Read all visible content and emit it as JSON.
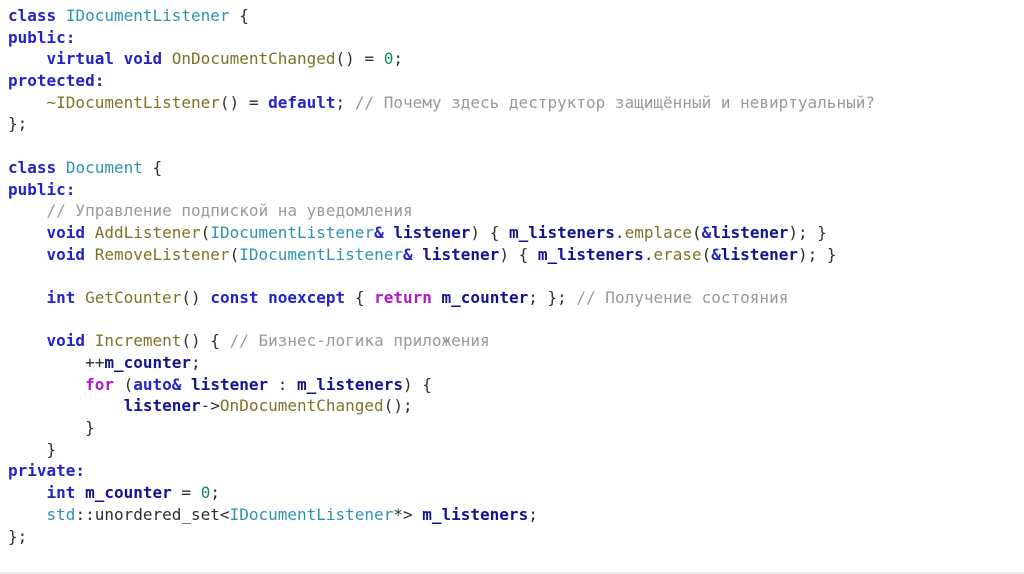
{
  "colors": {
    "keyword": "#2323c8",
    "control": "#b119c8",
    "type": "#2e93af",
    "function": "#7e7128",
    "variable": "#13138f",
    "number": "#12875f",
    "comment": "#9a9a9a",
    "plain": "#2e2e2e",
    "edge": "#ececec",
    "background": "#ffffff"
  },
  "code": {
    "language": "cpp",
    "lines": [
      {
        "tokens": [
          {
            "text": "class",
            "style": "keyword"
          },
          {
            "text": " ",
            "style": "plain"
          },
          {
            "text": "IDocumentListener",
            "style": "type"
          },
          {
            "text": " {",
            "style": "plain"
          }
        ]
      },
      {
        "tokens": [
          {
            "text": "public:",
            "style": "keyword"
          }
        ]
      },
      {
        "tokens": [
          {
            "text": "    ",
            "style": "plain"
          },
          {
            "text": "virtual",
            "style": "keyword"
          },
          {
            "text": " ",
            "style": "plain"
          },
          {
            "text": "void",
            "style": "keyword"
          },
          {
            "text": " ",
            "style": "plain"
          },
          {
            "text": "OnDocumentChanged",
            "style": "function"
          },
          {
            "text": "() = ",
            "style": "plain"
          },
          {
            "text": "0",
            "style": "number"
          },
          {
            "text": ";",
            "style": "plain"
          }
        ]
      },
      {
        "tokens": [
          {
            "text": "protected:",
            "style": "keyword"
          }
        ]
      },
      {
        "tokens": [
          {
            "text": "    ",
            "style": "plain"
          },
          {
            "text": "~IDocumentListener",
            "style": "function"
          },
          {
            "text": "() = ",
            "style": "plain"
          },
          {
            "text": "default",
            "style": "keyword"
          },
          {
            "text": "; ",
            "style": "plain"
          },
          {
            "text": "// Почему здесь деструктор защищённый и невиртуальный?",
            "style": "comment"
          }
        ]
      },
      {
        "tokens": [
          {
            "text": "};",
            "style": "plain"
          }
        ]
      },
      {
        "tokens": []
      },
      {
        "tokens": [
          {
            "text": "class",
            "style": "keyword"
          },
          {
            "text": " ",
            "style": "plain"
          },
          {
            "text": "Document",
            "style": "type"
          },
          {
            "text": " {",
            "style": "plain"
          }
        ]
      },
      {
        "tokens": [
          {
            "text": "public:",
            "style": "keyword"
          }
        ]
      },
      {
        "tokens": [
          {
            "text": "    ",
            "style": "plain"
          },
          {
            "text": "// Управление подпиской на уведомления",
            "style": "comment"
          }
        ]
      },
      {
        "tokens": [
          {
            "text": "    ",
            "style": "plain"
          },
          {
            "text": "void",
            "style": "keyword"
          },
          {
            "text": " ",
            "style": "plain"
          },
          {
            "text": "AddListener",
            "style": "function"
          },
          {
            "text": "(",
            "style": "plain"
          },
          {
            "text": "IDocumentListener",
            "style": "type"
          },
          {
            "text": "&",
            "style": "keyword"
          },
          {
            "text": " ",
            "style": "plain"
          },
          {
            "text": "listener",
            "style": "variable"
          },
          {
            "text": ") { ",
            "style": "plain"
          },
          {
            "text": "m_listeners",
            "style": "variable"
          },
          {
            "text": ".",
            "style": "plain"
          },
          {
            "text": "emplace",
            "style": "function"
          },
          {
            "text": "(",
            "style": "plain"
          },
          {
            "text": "&",
            "style": "keyword"
          },
          {
            "text": "listener",
            "style": "variable"
          },
          {
            "text": "); }",
            "style": "plain"
          }
        ]
      },
      {
        "tokens": [
          {
            "text": "    ",
            "style": "plain"
          },
          {
            "text": "void",
            "style": "keyword"
          },
          {
            "text": " ",
            "style": "plain"
          },
          {
            "text": "RemoveListener",
            "style": "function"
          },
          {
            "text": "(",
            "style": "plain"
          },
          {
            "text": "IDocumentListener",
            "style": "type"
          },
          {
            "text": "&",
            "style": "keyword"
          },
          {
            "text": " ",
            "style": "plain"
          },
          {
            "text": "listener",
            "style": "variable"
          },
          {
            "text": ") { ",
            "style": "plain"
          },
          {
            "text": "m_listeners",
            "style": "variable"
          },
          {
            "text": ".",
            "style": "plain"
          },
          {
            "text": "erase",
            "style": "function"
          },
          {
            "text": "(",
            "style": "plain"
          },
          {
            "text": "&",
            "style": "keyword"
          },
          {
            "text": "listener",
            "style": "variable"
          },
          {
            "text": "); }",
            "style": "plain"
          }
        ]
      },
      {
        "tokens": []
      },
      {
        "tokens": [
          {
            "text": "    ",
            "style": "plain"
          },
          {
            "text": "int",
            "style": "keyword"
          },
          {
            "text": " ",
            "style": "plain"
          },
          {
            "text": "GetCounter",
            "style": "function"
          },
          {
            "text": "() ",
            "style": "plain"
          },
          {
            "text": "const",
            "style": "keyword"
          },
          {
            "text": " ",
            "style": "plain"
          },
          {
            "text": "noexcept",
            "style": "keyword"
          },
          {
            "text": " { ",
            "style": "plain"
          },
          {
            "text": "return",
            "style": "control"
          },
          {
            "text": " ",
            "style": "plain"
          },
          {
            "text": "m_counter",
            "style": "variable"
          },
          {
            "text": "; }; ",
            "style": "plain"
          },
          {
            "text": "// Получение состояния",
            "style": "comment"
          }
        ]
      },
      {
        "tokens": []
      },
      {
        "tokens": [
          {
            "text": "    ",
            "style": "plain"
          },
          {
            "text": "void",
            "style": "keyword"
          },
          {
            "text": " ",
            "style": "plain"
          },
          {
            "text": "Increment",
            "style": "function"
          },
          {
            "text": "() { ",
            "style": "plain"
          },
          {
            "text": "// Бизнес-логика приложения",
            "style": "comment"
          }
        ]
      },
      {
        "tokens": [
          {
            "text": "        ++",
            "style": "plain"
          },
          {
            "text": "m_counter",
            "style": "variable"
          },
          {
            "text": ";",
            "style": "plain"
          }
        ]
      },
      {
        "tokens": [
          {
            "text": "        ",
            "style": "plain"
          },
          {
            "text": "for",
            "style": "control"
          },
          {
            "text": " (",
            "style": "plain"
          },
          {
            "text": "auto&",
            "style": "keyword"
          },
          {
            "text": " ",
            "style": "plain"
          },
          {
            "text": "listener",
            "style": "variable"
          },
          {
            "text": " : ",
            "style": "plain"
          },
          {
            "text": "m_listeners",
            "style": "variable"
          },
          {
            "text": ") {",
            "style": "plain"
          }
        ]
      },
      {
        "tokens": [
          {
            "text": "            ",
            "style": "plain"
          },
          {
            "text": "listener",
            "style": "variable"
          },
          {
            "text": "->",
            "style": "plain"
          },
          {
            "text": "OnDocumentChanged",
            "style": "function"
          },
          {
            "text": "();",
            "style": "plain"
          }
        ]
      },
      {
        "tokens": [
          {
            "text": "        }",
            "style": "plain"
          }
        ]
      },
      {
        "tokens": [
          {
            "text": "    }",
            "style": "plain"
          }
        ]
      },
      {
        "tokens": [
          {
            "text": "private:",
            "style": "keyword"
          }
        ]
      },
      {
        "tokens": [
          {
            "text": "    ",
            "style": "plain"
          },
          {
            "text": "int",
            "style": "keyword"
          },
          {
            "text": " ",
            "style": "plain"
          },
          {
            "text": "m_counter",
            "style": "variable"
          },
          {
            "text": " = ",
            "style": "plain"
          },
          {
            "text": "0",
            "style": "number"
          },
          {
            "text": ";",
            "style": "plain"
          }
        ]
      },
      {
        "tokens": [
          {
            "text": "    ",
            "style": "plain"
          },
          {
            "text": "std",
            "style": "type"
          },
          {
            "text": "::unordered_set<",
            "style": "plain"
          },
          {
            "text": "IDocumentListener",
            "style": "type"
          },
          {
            "text": "*> ",
            "style": "plain"
          },
          {
            "text": "m_listeners",
            "style": "variable"
          },
          {
            "text": ";",
            "style": "plain"
          }
        ]
      },
      {
        "tokens": [
          {
            "text": "};",
            "style": "plain"
          }
        ]
      }
    ]
  }
}
